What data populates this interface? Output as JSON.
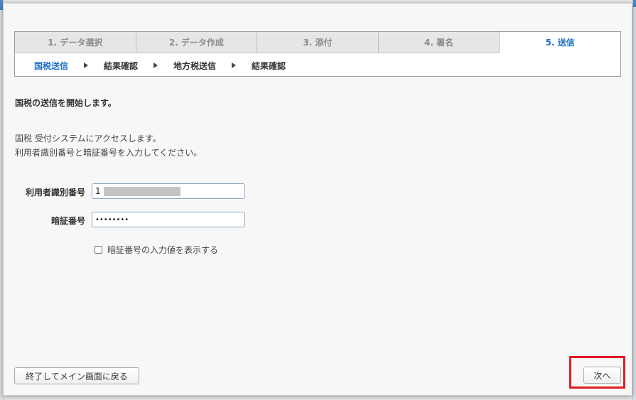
{
  "steps": {
    "tabs": [
      {
        "label": "1. データ選択",
        "active": false
      },
      {
        "label": "2. データ作成",
        "active": false
      },
      {
        "label": "3. 添付",
        "active": false
      },
      {
        "label": "4. 署名",
        "active": false
      },
      {
        "label": "5. 送信",
        "active": true
      }
    ],
    "substeps": [
      {
        "label": "国税送信",
        "active": true
      },
      {
        "label": "結果確認",
        "active": false
      },
      {
        "label": "地方税送信",
        "active": false
      },
      {
        "label": "結果確認",
        "active": false
      }
    ]
  },
  "main": {
    "heading": "国税の送信を開始します。",
    "description_line1": "国税 受付システムにアクセスします。",
    "description_line2": "利用者識別番号と暗証番号を入力してください。"
  },
  "form": {
    "user_id_label": "利用者識別番号",
    "user_id_value_visible": "1",
    "password_label": "暗証番号",
    "password_value": "••••••••",
    "show_password_label": "暗証番号の入力値を表示する",
    "show_password_checked": false
  },
  "footer": {
    "exit_button_label": "終了してメイン画面に戻る",
    "next_button_label": "次へ"
  },
  "colors": {
    "accent": "#1f6fc7",
    "highlight": "#e01b24"
  }
}
